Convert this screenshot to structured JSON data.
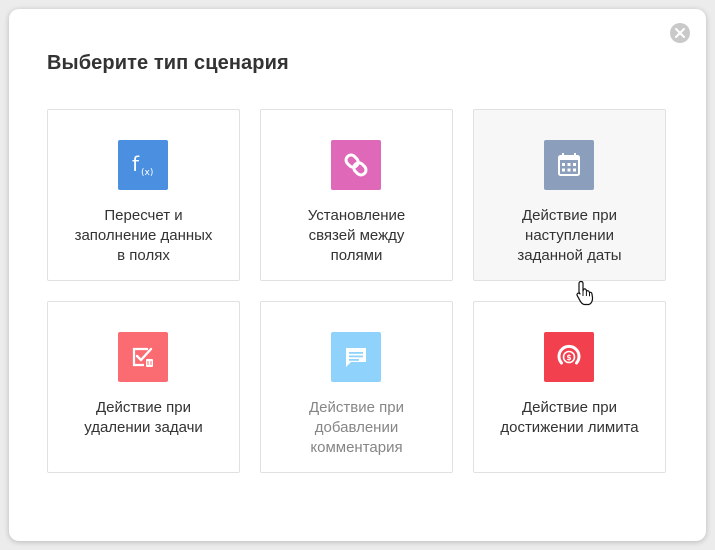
{
  "dialog": {
    "title": "Выберите тип сценария",
    "close_icon": "close-icon"
  },
  "cards": [
    {
      "label": "Пересчет и\nзаполнение данных\nв полях",
      "icon": "function-icon",
      "color": "#4a8fe0",
      "icon_text": "f",
      "icon_subtext": "(x)"
    },
    {
      "label": "Установление\nсвязей между\nполями",
      "icon": "link-icon",
      "color": "#e068b8"
    },
    {
      "label": "Действие при\nнаступлении\nзаданной даты",
      "icon": "calendar-icon",
      "color": "#8b9fbd",
      "state": "hovered"
    },
    {
      "label": "Действие при\nудалении задачи",
      "icon": "task-delete-icon",
      "color": "#fb6c72"
    },
    {
      "label": "Действие при\nдобавлении\nкомментария",
      "icon": "comment-icon",
      "color": "#8fd2fb",
      "state": "dimmed"
    },
    {
      "label": "Действие при\nдостижении лимита",
      "icon": "limit-icon",
      "color": "#f3404e"
    }
  ],
  "cursor_icon": "hand-pointer-icon"
}
